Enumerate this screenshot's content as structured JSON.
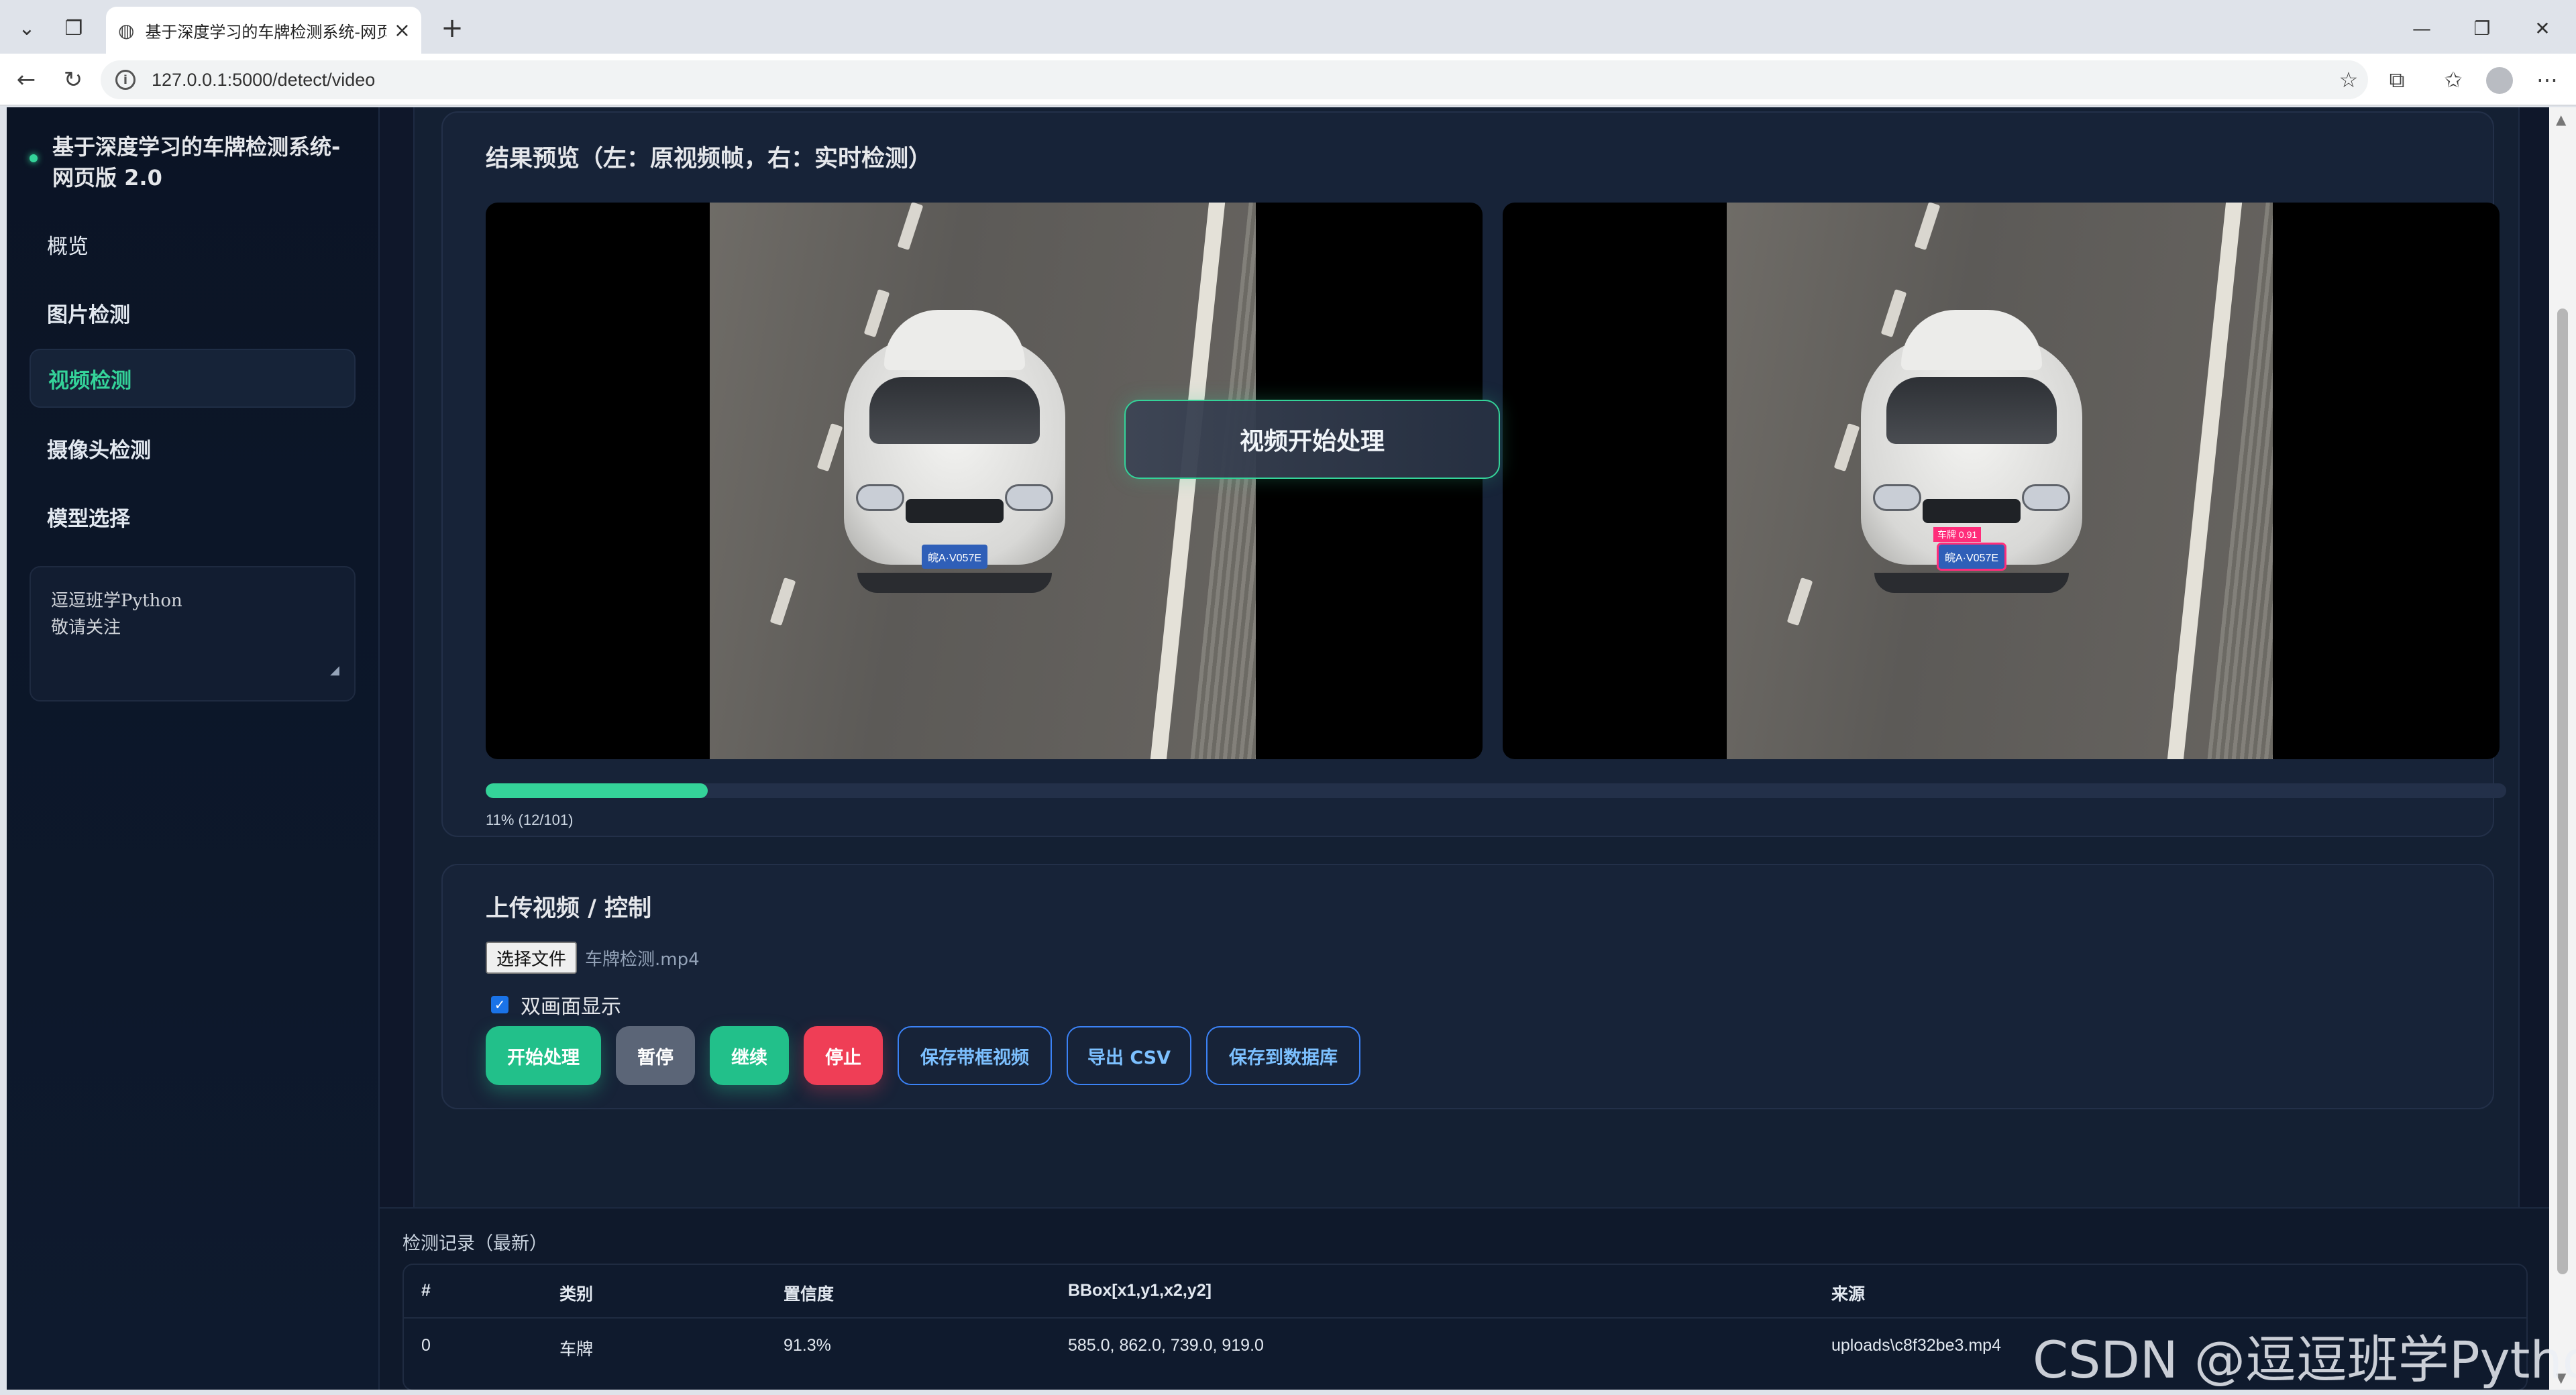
{
  "browser": {
    "tab_title": "基于深度学习的车牌检测系统-网页",
    "url": "127.0.0.1:5000/detect/video",
    "icons": [
      "chevron-down-icon",
      "tab-collections-icon",
      "globe-icon",
      "close-icon",
      "plus-icon",
      "minimize-icon",
      "restore-icon",
      "close-window-icon",
      "back-icon",
      "reload-icon",
      "info-icon",
      "star-icon",
      "extensions-icon",
      "favorites-icon",
      "profile-icon",
      "more-icon"
    ]
  },
  "sidebar": {
    "brand_title": "基于深度学习的车牌检测系统-网页版 2.0",
    "items": [
      {
        "label": "概览"
      },
      {
        "label": "图片检测"
      },
      {
        "label": "视频检测"
      },
      {
        "label": "摄像头检测"
      },
      {
        "label": "模型选择"
      }
    ],
    "note_line1": "逗逗班学Python",
    "note_line2": "敬请关注"
  },
  "preview": {
    "title": "结果预览（左：原视频帧，右：实时检测）",
    "toast": "视频开始处理",
    "plate_text": "皖A·V057E",
    "box_label": "车牌 0.91",
    "progress_percent": 11,
    "progress_text": "11% (12/101)"
  },
  "upload": {
    "title": "上传视频 / 控制",
    "choose_file": "选择文件",
    "file_name": "车牌检测.mp4",
    "dual_view_label": "双画面显示",
    "dual_view_checked": true,
    "buttons": {
      "start": "开始处理",
      "pause": "暂停",
      "resume": "继续",
      "stop": "停止",
      "save_video": "保存带框视频",
      "export_csv": "导出 CSV",
      "save_db": "保存到数据库"
    }
  },
  "records": {
    "title": "检测记录（最新）",
    "columns": [
      "#",
      "类别",
      "置信度",
      "BBox[x1,y1,x2,y2]",
      "来源"
    ],
    "rows": [
      [
        "0",
        "车牌",
        "91.3%",
        "585.0, 862.0, 739.0, 919.0",
        "uploads\\c8f32be3.mp4"
      ]
    ]
  },
  "watermark": "CSDN @逗逗班学Python",
  "colors": {
    "accent": "#34d399",
    "background": "#0f172a",
    "danger": "#ef3e56",
    "outline_blue": "#3b82f6"
  }
}
